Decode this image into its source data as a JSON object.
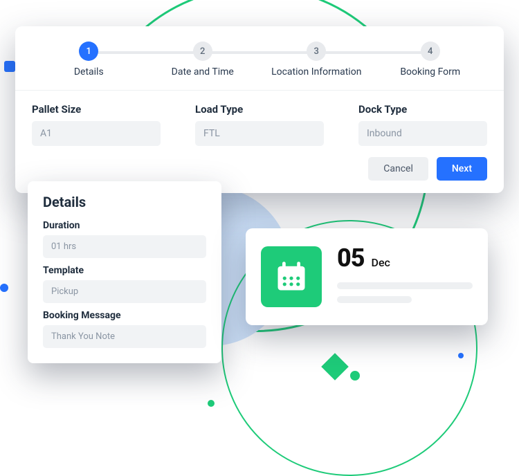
{
  "wizard": {
    "steps": [
      {
        "num": "1",
        "label": "Details"
      },
      {
        "num": "2",
        "label": "Date and Time"
      },
      {
        "num": "3",
        "label": "Location Information"
      },
      {
        "num": "4",
        "label": "Booking Form"
      }
    ],
    "fields": {
      "pallet_size": {
        "label": "Pallet Size",
        "value": "A1"
      },
      "load_type": {
        "label": "Load Type",
        "value": "FTL"
      },
      "dock_type": {
        "label": "Dock Type",
        "value": "Inbound"
      }
    },
    "actions": {
      "cancel": "Cancel",
      "next": "Next"
    }
  },
  "details": {
    "title": "Details",
    "duration": {
      "label": "Duration",
      "value": "01 hrs"
    },
    "template": {
      "label": "Template",
      "value": "Pickup"
    },
    "booking_message": {
      "label": "Booking Message",
      "value": "Thank You Note"
    }
  },
  "date_card": {
    "day": "05",
    "month": "Dec",
    "icon": "calendar-icon"
  },
  "colors": {
    "primary": "#2571ff",
    "accent": "#1ecb79"
  }
}
